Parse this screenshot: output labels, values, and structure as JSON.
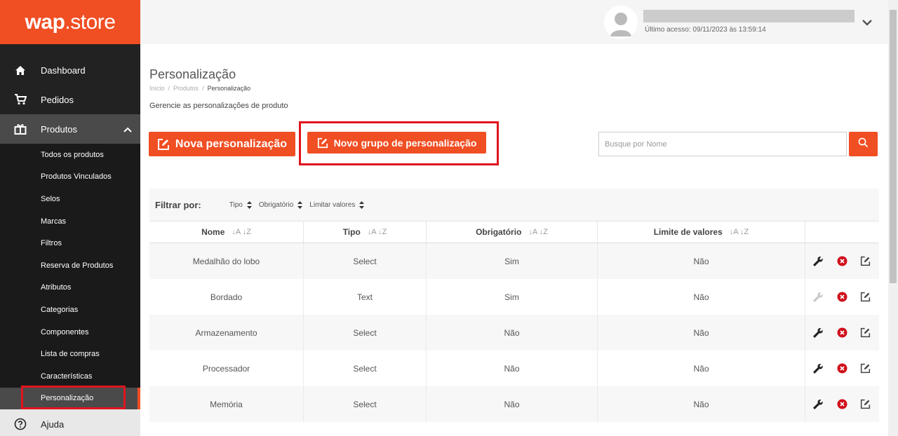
{
  "brand": {
    "logo_bold": "wap",
    "logo_rest": ".store"
  },
  "sidebar": {
    "main_items": [
      {
        "label": "Dashboard",
        "icon": "home-icon"
      },
      {
        "label": "Pedidos",
        "icon": "cart-icon"
      },
      {
        "label": "Produtos",
        "icon": "box-icon"
      }
    ],
    "sub_items": [
      "Todos os produtos",
      "Produtos Vinculados",
      "Selos",
      "Marcas",
      "Filtros",
      "Reserva de Produtos",
      "Atributos",
      "Categorias",
      "Componentes",
      "Lista de compras",
      "Características",
      "Personalização"
    ],
    "help_label": "Ajuda"
  },
  "header": {
    "last_access": "Último acesso: 09/11/2023 às 13:59:14"
  },
  "page": {
    "title": "Personalização",
    "breadcrumb": [
      "Início",
      "Produtos",
      "Personalização"
    ],
    "subtitle": "Gerencie as personalizações de produto",
    "btn_new": "Nova personalização",
    "btn_group": "Novo grupo de personalização",
    "search_placeholder": "Busque por Nome"
  },
  "filter": {
    "label": "Filtrar por:",
    "options": [
      "Tipo",
      "Obrigatório",
      "Limitar valores"
    ]
  },
  "table": {
    "columns": [
      "Nome",
      "Tipo",
      "Obrigatório",
      "Limite de valores"
    ],
    "rows": [
      {
        "nome": "Medalhão do lobo",
        "tipo": "Select",
        "obrigatorio": "Sim",
        "limite": "Não"
      },
      {
        "nome": "Bordado",
        "tipo": "Text",
        "obrigatorio": "Sim",
        "limite": "Não"
      },
      {
        "nome": "Armazenamento",
        "tipo": "Select",
        "obrigatorio": "Não",
        "limite": "Não"
      },
      {
        "nome": "Processador",
        "tipo": "Select",
        "obrigatorio": "Não",
        "limite": "Não"
      },
      {
        "nome": "Memória",
        "tipo": "Select",
        "obrigatorio": "Não",
        "limite": "Não"
      }
    ]
  },
  "colors": {
    "accent": "#f04e23",
    "highlight": "#e0141e",
    "sidebar": "#222222"
  }
}
